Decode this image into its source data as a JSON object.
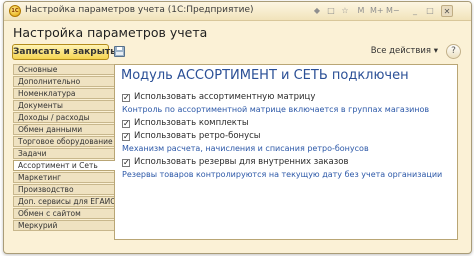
{
  "window": {
    "title": "Настройка параметров учета  (1С:Предприятие)",
    "app_icon_glyph": "1С",
    "controls": [
      "◆",
      "□",
      "☆",
      "M",
      "M+",
      "M−",
      "_",
      "□",
      "✕"
    ]
  },
  "page_title": "Настройка параметров учета",
  "toolbar": {
    "save_close_label": "Записать и закрыть",
    "all_actions_label": "Все действия ▾",
    "help_label": "?"
  },
  "tabs": [
    {
      "label": "Основные",
      "active": false
    },
    {
      "label": "Дополнительно",
      "active": false
    },
    {
      "label": "Номенклатура",
      "active": false
    },
    {
      "label": "Документы",
      "active": false
    },
    {
      "label": "Доходы / расходы",
      "active": false
    },
    {
      "label": "Обмен данными",
      "active": false
    },
    {
      "label": "Торговое оборудование",
      "active": false
    },
    {
      "label": "Задачи",
      "active": false
    },
    {
      "label": "Ассортимент и Сеть",
      "active": true
    },
    {
      "label": "Маркетинг",
      "active": false
    },
    {
      "label": "Производство",
      "active": false
    },
    {
      "label": "Доп. сервисы для ЕГАИС",
      "active": false
    },
    {
      "label": "Обмен с сайтом",
      "active": false
    },
    {
      "label": "Меркурий",
      "active": false
    }
  ],
  "content": {
    "heading": "Модуль АССОРТИМЕНТ и СЕТЬ подключен",
    "options": [
      {
        "label": "Использовать ассортиментную матрицу",
        "checked": true
      },
      {
        "label": "Использовать комплекты",
        "checked": true
      },
      {
        "label": "Использовать ретро-бонусы",
        "checked": true
      },
      {
        "label": "Использовать резервы для внутренних заказов",
        "checked": true
      }
    ],
    "notes": [
      "Контроль по ассортиментной матрице включается в группах магазинов",
      "Механизм расчета, начисления и списания ретро-бонусов",
      "Резервы товаров контролируются на текущую дату без учета организации"
    ],
    "check_glyph": "✓"
  }
}
